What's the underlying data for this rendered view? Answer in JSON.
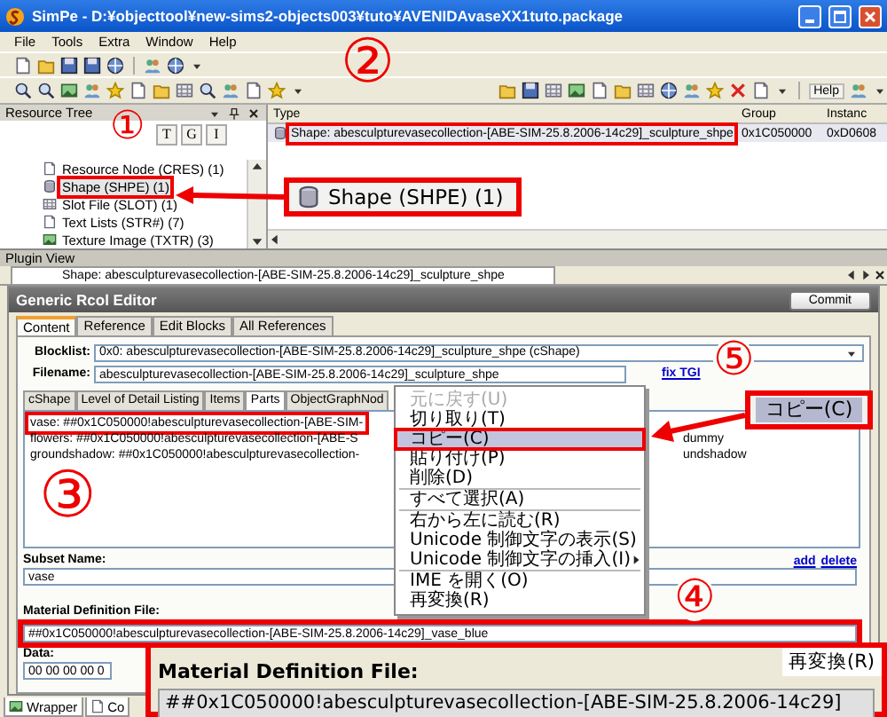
{
  "window": {
    "title": "SimPe - D:¥objecttool¥new-sims2-objects003¥tuto¥AVENIDAvaseXX1tuto.package"
  },
  "menu": [
    "File",
    "Tools",
    "Extra",
    "Window",
    "Help"
  ],
  "toolbar": {
    "help_button": "Help"
  },
  "resource_tree": {
    "title": "Resource Tree",
    "filter_buttons": [
      "T",
      "G",
      "I"
    ],
    "items": [
      {
        "label": "Resource Node (CRES) (1)",
        "selected": false,
        "annotated": false
      },
      {
        "label": "Shape (SHPE) (1)",
        "selected": true,
        "annotated": true
      },
      {
        "label": "Slot File (SLOT) (1)",
        "selected": false,
        "annotated": false
      },
      {
        "label": "Text Lists (STR#) (7)",
        "selected": false,
        "annotated": false
      },
      {
        "label": "Texture Image (TXTR) (3)",
        "selected": false,
        "annotated": false
      }
    ]
  },
  "resource_list": {
    "columns": [
      "Type",
      "Group",
      "Instanc"
    ],
    "rows": [
      {
        "cells": [
          "Shape: abesculpturevasecollection-[ABE-SIM-25.8.2006-14c29]_sculpture_shpe",
          "0x1C050000",
          "0xD0608"
        ],
        "selected": true,
        "annotated": true
      }
    ]
  },
  "plugin_view": {
    "title": "Plugin View",
    "document_tab": "Shape: abesculpturevasecollection-[ABE-SIM-25.8.2006-14c29]_sculpture_shpe",
    "editor_title": "Generic Rcol Editor",
    "commit_button": "Commit",
    "tabs": [
      {
        "label": "Content",
        "selected": true
      },
      {
        "label": "Reference",
        "selected": false
      },
      {
        "label": "Edit Blocks",
        "selected": false
      },
      {
        "label": "All References",
        "selected": false
      }
    ],
    "blocklist": {
      "label": "Blocklist:",
      "value": "0x0: abesculpturevasecollection-[ABE-SIM-25.8.2006-14c29]_sculpture_shpe (cShape)"
    },
    "filename": {
      "label": "Filename:",
      "value": "abesculpturevasecollection-[ABE-SIM-25.8.2006-14c29]_sculpture_shpe"
    },
    "fix_tgi_link": "fix TGI",
    "subtabs": [
      {
        "label": "cShape",
        "selected": false
      },
      {
        "label": "Level of Detail Listing",
        "selected": false
      },
      {
        "label": "Items",
        "selected": false
      },
      {
        "label": "Parts",
        "selected": true
      },
      {
        "label": "ObjectGraphNod",
        "selected": false
      }
    ],
    "parts_list": [
      {
        "text": "vase: ##0x1C050000!abesculpturevasecollection-[ABE-SIM-",
        "annotated": true
      },
      {
        "text": "flowers: ##0x1C050000!abesculpturevasecollection-[ABE-S",
        "tail": "dummy",
        "annotated": false
      },
      {
        "text": "groundshadow: ##0x1C050000!abesculpturevasecollection-",
        "tail": "undshadow",
        "annotated": false
      }
    ],
    "subset_name": {
      "label": "Subset Name:",
      "value": "vase"
    },
    "add_link": "add",
    "delete_link": "delete",
    "material": {
      "label": "Material Definition File:",
      "value": "##0x1C050000!abesculpturevasecollection-[ABE-SIM-25.8.2006-14c29]_vase_blue",
      "annotated": true
    },
    "data": {
      "label": "Data:",
      "value": "00 00 00 00 0"
    }
  },
  "bottom_tabs": [
    "Wrapper",
    "Co"
  ],
  "context_menu": [
    {
      "kind": "item",
      "label": "元に戻す(U)",
      "disabled": true,
      "selected": false,
      "submenu": false,
      "annotated": false
    },
    {
      "kind": "item",
      "label": "切り取り(T)",
      "disabled": false,
      "selected": false,
      "submenu": false,
      "annotated": false
    },
    {
      "kind": "item",
      "label": "コピー(C)",
      "disabled": false,
      "selected": true,
      "submenu": false,
      "annotated": true
    },
    {
      "kind": "item",
      "label": "貼り付け(P)",
      "disabled": false,
      "selected": false,
      "submenu": false,
      "annotated": false
    },
    {
      "kind": "item",
      "label": "削除(D)",
      "disabled": false,
      "selected": false,
      "submenu": false,
      "annotated": false
    },
    {
      "kind": "separator"
    },
    {
      "kind": "item",
      "label": "すべて選択(A)",
      "disabled": false,
      "selected": false,
      "submenu": false,
      "annotated": false
    },
    {
      "kind": "separator"
    },
    {
      "kind": "item",
      "label": "右から左に読む(R)",
      "disabled": false,
      "selected": false,
      "submenu": false,
      "annotated": false
    },
    {
      "kind": "item",
      "label": "Unicode 制御文字の表示(S)",
      "disabled": false,
      "selected": false,
      "submenu": false,
      "annotated": false
    },
    {
      "kind": "item",
      "label": "Unicode 制御文字の挿入(I)",
      "disabled": false,
      "selected": false,
      "submenu": true,
      "annotated": false
    },
    {
      "kind": "separator"
    },
    {
      "kind": "item",
      "label": "IME を開く(O)",
      "disabled": false,
      "selected": false,
      "submenu": false,
      "annotated": false
    },
    {
      "kind": "item",
      "label": "再変換(R)",
      "disabled": false,
      "selected": false,
      "submenu": false,
      "annotated": false
    }
  ],
  "annotations": {
    "markers": [
      "①",
      "②",
      "③",
      "④",
      "⑤"
    ],
    "insets": [
      {
        "kind": "tree_item",
        "label": "Shape (SHPE) (1)"
      },
      {
        "kind": "menu_item",
        "label": "コピー(C)"
      },
      {
        "kind": "field",
        "label": "Material Definition File:",
        "value": "##0x1C050000!abesculpturevasecollection-[ABE-SIM-25.8.2006-14c29]",
        "menu_item": "再変換(R)"
      }
    ]
  }
}
